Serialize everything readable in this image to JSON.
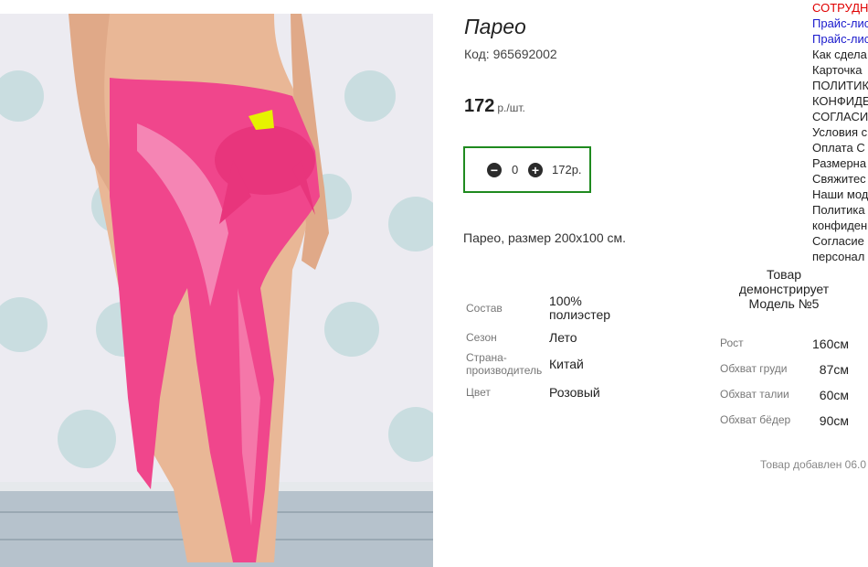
{
  "product": {
    "title": "Парео",
    "code": "Код: 965692002",
    "price": "172",
    "price_unit": "р./шт.",
    "quantity": "0",
    "sum": "172р.",
    "description": "Парео, размер 200х100 см."
  },
  "specs": [
    {
      "label": "Состав",
      "value": "100% полиэстер"
    },
    {
      "label": "Сезон",
      "value": "Лето"
    },
    {
      "label": "Страна-производитель",
      "value": "Китай"
    },
    {
      "label": "Цвет",
      "value": "Розовый"
    }
  ],
  "model": {
    "title": "Товар демонстрирует Модель №5",
    "measures": [
      {
        "label": "Рост",
        "value": "160см"
      },
      {
        "label": "Обхват груди",
        "value": "87см"
      },
      {
        "label": "Обхват талии",
        "value": "60см"
      },
      {
        "label": "Обхват бёдер",
        "value": "90см"
      }
    ]
  },
  "added_text": "Товар добавлен 06.0",
  "side_links": [
    {
      "text": "СОТРУДН",
      "color": "red"
    },
    {
      "text": "Прайс-лис",
      "color": "blue"
    },
    {
      "text": "Прайс-лис",
      "color": "blue"
    },
    {
      "text": "Как сдела",
      "color": "dark"
    },
    {
      "text": "Карточка",
      "color": "dark"
    },
    {
      "text": "ПОЛИТИК",
      "color": "dark"
    },
    {
      "text": "КОНФИДЕ",
      "color": "dark"
    },
    {
      "text": "СОГЛАСИ",
      "color": "dark"
    },
    {
      "text": "Условия с",
      "color": "dark"
    },
    {
      "text": "Оплата С",
      "color": "dark"
    },
    {
      "text": "Размерна",
      "color": "dark"
    },
    {
      "text": "Свяжитес",
      "color": "dark"
    },
    {
      "text": "Наши мод",
      "color": "dark"
    },
    {
      "text": "Политика",
      "color": "dark"
    },
    {
      "text": "конфиден",
      "color": "dark"
    },
    {
      "text": "Согласие",
      "color": "dark"
    },
    {
      "text": "персонал",
      "color": "dark"
    }
  ],
  "colors": {
    "cart_border": "#1f8a1f",
    "link_red": "#e00000",
    "link_blue": "#1a1acc"
  }
}
